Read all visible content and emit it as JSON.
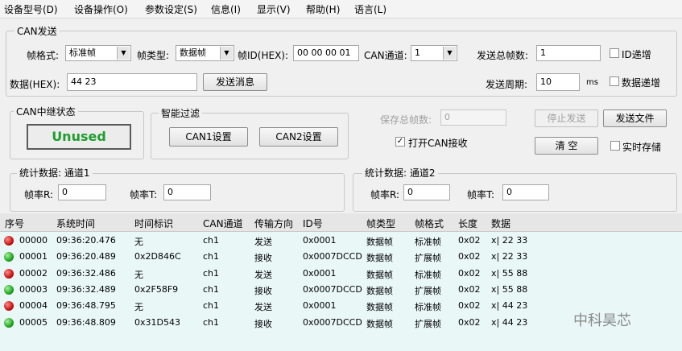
{
  "menu": [
    "设备型号(D)",
    "设备操作(O)",
    "参数设定(S)",
    "信息(I)",
    "显示(V)",
    "帮助(H)",
    "语言(L)"
  ],
  "can_send": {
    "title": "CAN发送",
    "frame_format_label": "帧格式:",
    "frame_format_value": "标准帧",
    "frame_type_label": "帧类型:",
    "frame_type_value": "数据帧",
    "frame_id_label": "帧ID(HEX):",
    "frame_id_value": "00 00 00 01",
    "can_channel_label": "CAN通道:",
    "can_channel_value": "1",
    "total_frames_label": "发送总帧数:",
    "total_frames_value": "1",
    "id_increment_label": "ID递增",
    "data_label": "数据(HEX):",
    "data_value": "44 23",
    "send_button": "发送消息",
    "period_label": "发送周期:",
    "period_value": "10",
    "period_unit": "ms",
    "data_increment_label": "数据递增"
  },
  "relay": {
    "title": "CAN中继状态",
    "status": "Unused"
  },
  "filter": {
    "title": "智能过滤",
    "can1_button": "CAN1设置",
    "can2_button": "CAN2设置"
  },
  "save": {
    "total_label": "保存总帧数:",
    "total_value": "0",
    "open_receive_label": "打开CAN接收",
    "stop_button": "停止发送",
    "send_file_button": "发送文件",
    "clear_button": "清 空",
    "realtime_label": "实时存储"
  },
  "stats1": {
    "title": "统计数据: 通道1",
    "rate_r_label": "帧率R:",
    "rate_r_value": "0",
    "rate_t_label": "帧率T:",
    "rate_t_value": "0"
  },
  "stats2": {
    "title": "统计数据: 通道2",
    "rate_r_label": "帧率R:",
    "rate_r_value": "0",
    "rate_t_label": "帧率T:",
    "rate_t_value": "0"
  },
  "table": {
    "columns": [
      "序号",
      "系统时间",
      "时间标识",
      "CAN通道",
      "传输方向",
      "ID号",
      "帧类型",
      "帧格式",
      "长度",
      "数据"
    ],
    "rows": [
      {
        "status": "red",
        "no": "00000",
        "sys_time": "09:36:20.476",
        "time_id": "无",
        "channel": "ch1",
        "direction": "发送",
        "id": "0x0001",
        "frame_type": "数据帧",
        "frame_format": "标准帧",
        "length": "0x02",
        "data": "x| 22 33"
      },
      {
        "status": "green",
        "no": "00001",
        "sys_time": "09:36:20.489",
        "time_id": "0x2D846C",
        "channel": "ch1",
        "direction": "接收",
        "id": "0x0007DCCD",
        "frame_type": "数据帧",
        "frame_format": "扩展帧",
        "length": "0x02",
        "data": "x| 22 33"
      },
      {
        "status": "red",
        "no": "00002",
        "sys_time": "09:36:32.486",
        "time_id": "无",
        "channel": "ch1",
        "direction": "发送",
        "id": "0x0001",
        "frame_type": "数据帧",
        "frame_format": "标准帧",
        "length": "0x02",
        "data": "x| 55 88"
      },
      {
        "status": "green",
        "no": "00003",
        "sys_time": "09:36:32.489",
        "time_id": "0x2F58F9",
        "channel": "ch1",
        "direction": "接收",
        "id": "0x0007DCCD",
        "frame_type": "数据帧",
        "frame_format": "扩展帧",
        "length": "0x02",
        "data": "x| 55 88"
      },
      {
        "status": "red",
        "no": "00004",
        "sys_time": "09:36:48.795",
        "time_id": "无",
        "channel": "ch1",
        "direction": "发送",
        "id": "0x0001",
        "frame_type": "数据帧",
        "frame_format": "标准帧",
        "length": "0x02",
        "data": "x| 44 23"
      },
      {
        "status": "green",
        "no": "00005",
        "sys_time": "09:36:48.809",
        "time_id": "0x31D543",
        "channel": "ch1",
        "direction": "接收",
        "id": "0x0007DCCD",
        "frame_type": "数据帧",
        "frame_format": "扩展帧",
        "length": "0x02",
        "data": "x| 44 23"
      }
    ]
  },
  "watermark": "中科昊芯"
}
